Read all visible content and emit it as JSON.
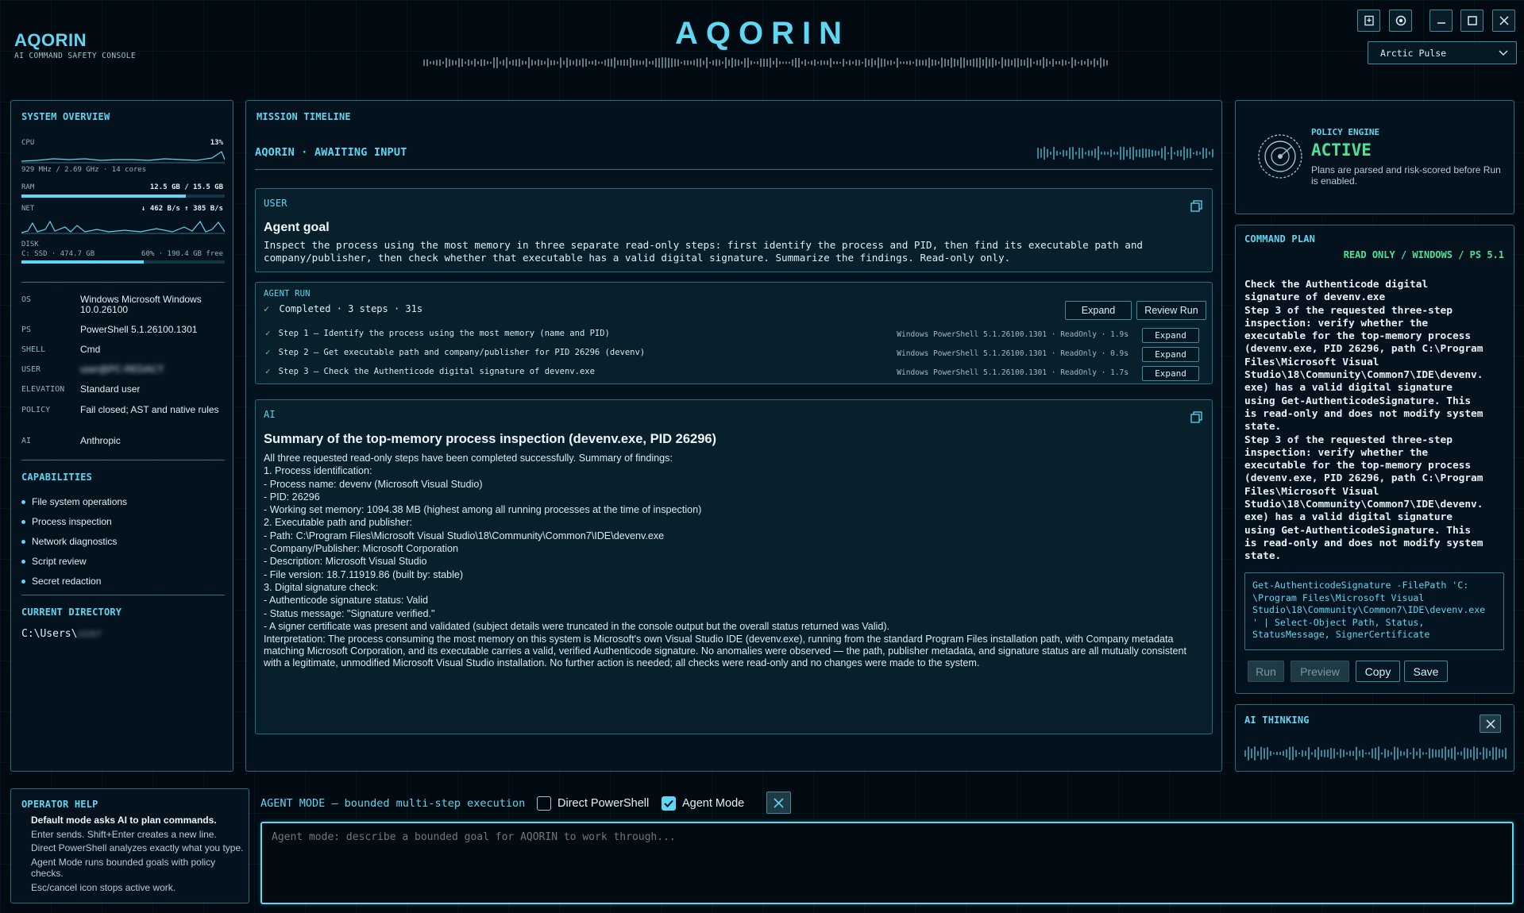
{
  "app": {
    "logo": "AQORIN",
    "subtitle": "AI COMMAND SAFETY CONSOLE",
    "center_title": "AQORIN",
    "theme_selected": "Arctic Pulse"
  },
  "system_overview": {
    "title": "SYSTEM OVERVIEW",
    "cpu_label": "CPU",
    "cpu_value": "13%",
    "cpu_detail": "929 MHz / 2.69 GHz · 14 cores",
    "ram_label": "RAM",
    "ram_value": "12.5 GB / 15.5 GB",
    "ram_fraction": 0.81,
    "net_label": "NET",
    "net_value": "↓ 462 B/s  ↑ 385 B/s",
    "disk_label": "DISK",
    "disk_left": "C: SSD · 474.7 GB",
    "disk_right": "60% · 190.4 GB free",
    "disk_fraction": 0.6,
    "info": [
      {
        "key": "OS",
        "value": "Windows Microsoft Windows 10.0.26100"
      },
      {
        "key": "PS",
        "value": "PowerShell 5.1.26100.1301"
      },
      {
        "key": "SHELL",
        "value": "Cmd"
      },
      {
        "key": "USER",
        "value": "user@PC-REDACT"
      },
      {
        "key": "ELEVATION",
        "value": "Standard user"
      },
      {
        "key": "POLICY",
        "value": "Fail closed; AST and native rules"
      },
      {
        "key": "AI",
        "value": "Anthropic"
      }
    ],
    "capabilities_title": "CAPABILITIES",
    "capabilities": [
      "File system operations",
      "Process inspection",
      "Network diagnostics",
      "Script review",
      "Secret redaction"
    ],
    "current_dir_title": "CURRENT DIRECTORY",
    "current_dir": "C:\\Users\\",
    "current_dir_user": "user"
  },
  "timeline": {
    "title": "MISSION TIMELINE",
    "status": "AQORIN · AWAITING INPUT",
    "user_card": {
      "role": "USER",
      "heading": "Agent goal",
      "text": "Inspect the process using the most memory in three separate read-only steps: first identify the process and PID, then find its executable path and company/publisher, then check whether that executable has a valid digital signature. Summarize the findings. Read-only only."
    },
    "agent_run": {
      "title": "AGENT RUN",
      "check": "✓",
      "summary": "Completed · 3 steps · 31s",
      "expand_label": "Expand",
      "review_label": "Review Run",
      "steps": [
        {
          "text": "Step 1 — Identify the process using the most memory (name and PID)",
          "meta": "Windows PowerShell 5.1.26100.1301 · ReadOnly · 1.9s",
          "btn": "Expand"
        },
        {
          "text": "Step 2 — Get executable path and company/publisher for PID 26296 (devenv)",
          "meta": "Windows PowerShell 5.1.26100.1301 · ReadOnly · 0.9s",
          "btn": "Expand"
        },
        {
          "text": "Step 3 — Check the Authenticode digital signature of devenv.exe",
          "meta": "Windows PowerShell 5.1.26100.1301 · ReadOnly · 1.7s",
          "btn": "Expand"
        }
      ]
    },
    "ai_card": {
      "role": "AI",
      "heading": "Summary of the top-memory process inspection (devenv.exe, PID 26296)",
      "lines": [
        "All three requested read-only steps have been completed successfully. Summary of findings:",
        "1. Process identification:",
        "- Process name: devenv (Microsoft Visual Studio)",
        "- PID: 26296",
        "- Working set memory: 1094.38 MB (highest among all running processes at the time of inspection)",
        "2. Executable path and publisher:",
        "- Path: C:\\Program Files\\Microsoft Visual Studio\\18\\Community\\Common7\\IDE\\devenv.exe",
        "- Company/Publisher: Microsoft Corporation",
        "- Description: Microsoft Visual Studio",
        "- File version: 18.7.11919.86 (built by: stable)",
        "3. Digital signature check:",
        "- Authenticode signature status: Valid",
        "- Status message: \"Signature verified.\"",
        "- A signer certificate was present and validated (subject details were truncated in the console output but the overall status returned was Valid)."
      ],
      "interpretation": "Interpretation: The process consuming the most memory on this system is Microsoft's own Visual Studio IDE (devenv.exe), running from the standard Program Files installation path, with Company metadata matching Microsoft Corporation, and its executable carries a valid, verified Authenticode signature. No anomalies were observed — the path, publisher metadata, and signature status are all mutually consistent with a legitimate, unmodified Microsoft Visual Studio installation. No further action is needed; all checks were read-only and no changes were made to the system."
    }
  },
  "policy_engine": {
    "title": "POLICY ENGINE",
    "status": "ACTIVE",
    "description": "Plans are parsed and risk-scored before Run is enabled."
  },
  "command_plan": {
    "title": "COMMAND PLAN",
    "mode": "READ ONLY / WINDOWS / PS 5.1",
    "text": "Check the Authenticode digital\nsignature of devenv.exe\nStep 3 of the requested three-step\ninspection: verify whether the\nexecutable for the top-memory process\n(devenv.exe, PID 26296, path C:\\Program\nFiles\\Microsoft Visual\nStudio\\18\\Community\\Common7\\IDE\\devenv.\nexe) has a valid digital signature\nusing Get-AuthenticodeSignature. This\nis read-only and does not modify system\nstate.\nStep 3 of the requested three-step\ninspection: verify whether the\nexecutable for the top-memory process\n(devenv.exe, PID 26296, path C:\\Program\nFiles\\Microsoft Visual\nStudio\\18\\Community\\Common7\\IDE\\devenv.\nexe) has a valid digital signature\nusing Get-AuthenticodeSignature. This\nis read-only and does not modify system\nstate.",
    "code": "Get-AuthenticodeSignature -FilePath 'C:\n\\Program Files\\Microsoft Visual\nStudio\\18\\Community\\Common7\\IDE\\devenv.exe\n' | Select-Object Path, Status,\nStatusMessage, SignerCertificate",
    "run_label": "Run",
    "preview_label": "Preview",
    "copy_label": "Copy",
    "save_label": "Save"
  },
  "ai_thinking": {
    "title": "AI THINKING"
  },
  "operator_help": {
    "title": "OPERATOR HELP",
    "lines": [
      "Default mode asks AI to plan commands.",
      "Enter sends. Shift+Enter creates a new line.",
      "Direct PowerShell analyzes exactly what you type.",
      "Agent Mode runs bounded goals with policy checks.",
      "Esc/cancel icon stops active work."
    ]
  },
  "composer": {
    "mode_label": "AGENT MODE — bounded multi-step execution",
    "direct_ps_label": "Direct PowerShell",
    "direct_ps_checked": false,
    "agent_mode_label": "Agent Mode",
    "agent_mode_checked": true,
    "placeholder": "Agent mode: describe a bounded goal for AQORIN to work through..."
  },
  "colors": {
    "accent": "#5fd6f2",
    "success": "#4fe09a",
    "background": "#020a11",
    "border": "#1d6f86"
  }
}
